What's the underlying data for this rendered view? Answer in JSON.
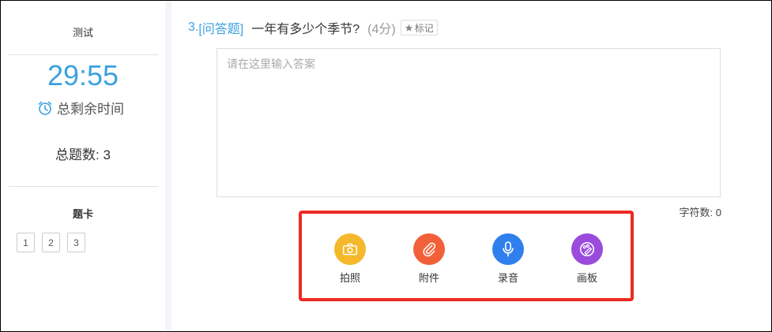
{
  "sidebar": {
    "title": "测试",
    "timer": "29:55",
    "remaining_label": "总剩余时间",
    "total_label": "总题数: 3",
    "card_title": "题卡",
    "cards": [
      "1",
      "2",
      "3"
    ]
  },
  "question": {
    "number": "3.",
    "type": "[问答题]",
    "text": "一年有多少个季节?",
    "score": "(4分)",
    "mark_label": "标记"
  },
  "answer": {
    "placeholder": "请在这里输入答案",
    "value": "",
    "char_count": "字符数: 0"
  },
  "tools": [
    {
      "label": "拍照",
      "icon": "camera-icon",
      "color": "#f5b82a"
    },
    {
      "label": "附件",
      "icon": "paperclip-icon",
      "color": "#f2603a"
    },
    {
      "label": "录音",
      "icon": "microphone-icon",
      "color": "#2f80ed"
    },
    {
      "label": "画板",
      "icon": "palette-icon",
      "color": "#9b4bdc"
    }
  ],
  "colors": {
    "accent": "#3ba1e0",
    "highlight_border": "#ee2a24"
  }
}
